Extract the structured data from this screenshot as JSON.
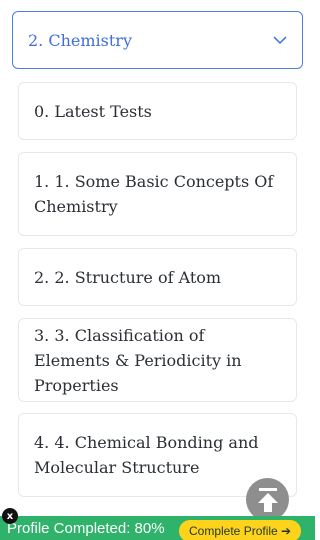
{
  "selector": {
    "value": "2. Chemistry",
    "icon": "chevron-down-icon"
  },
  "chapters": [
    {
      "label": "0. Latest Tests"
    },
    {
      "label": "1. 1. Some Basic Concepts Of Chemistry"
    },
    {
      "label": "2. 2. Structure of Atom"
    },
    {
      "label": "3. 3. Classification of Elements & Periodicity in Properties"
    },
    {
      "label": "4. 4. Chemical Bonding and Molecular Structure"
    }
  ],
  "scroll_top": {
    "icon": "arrow-up-to-top-icon"
  },
  "profile_bar": {
    "status": "Profile Completed: 80%",
    "button": "Complete Profile ➔",
    "close_icon": "close-icon",
    "close_glyph": "x",
    "colors": {
      "bar": "#2fb36b",
      "button": "#ffd21c"
    }
  },
  "colors": {
    "accent": "#3f6fd8"
  }
}
